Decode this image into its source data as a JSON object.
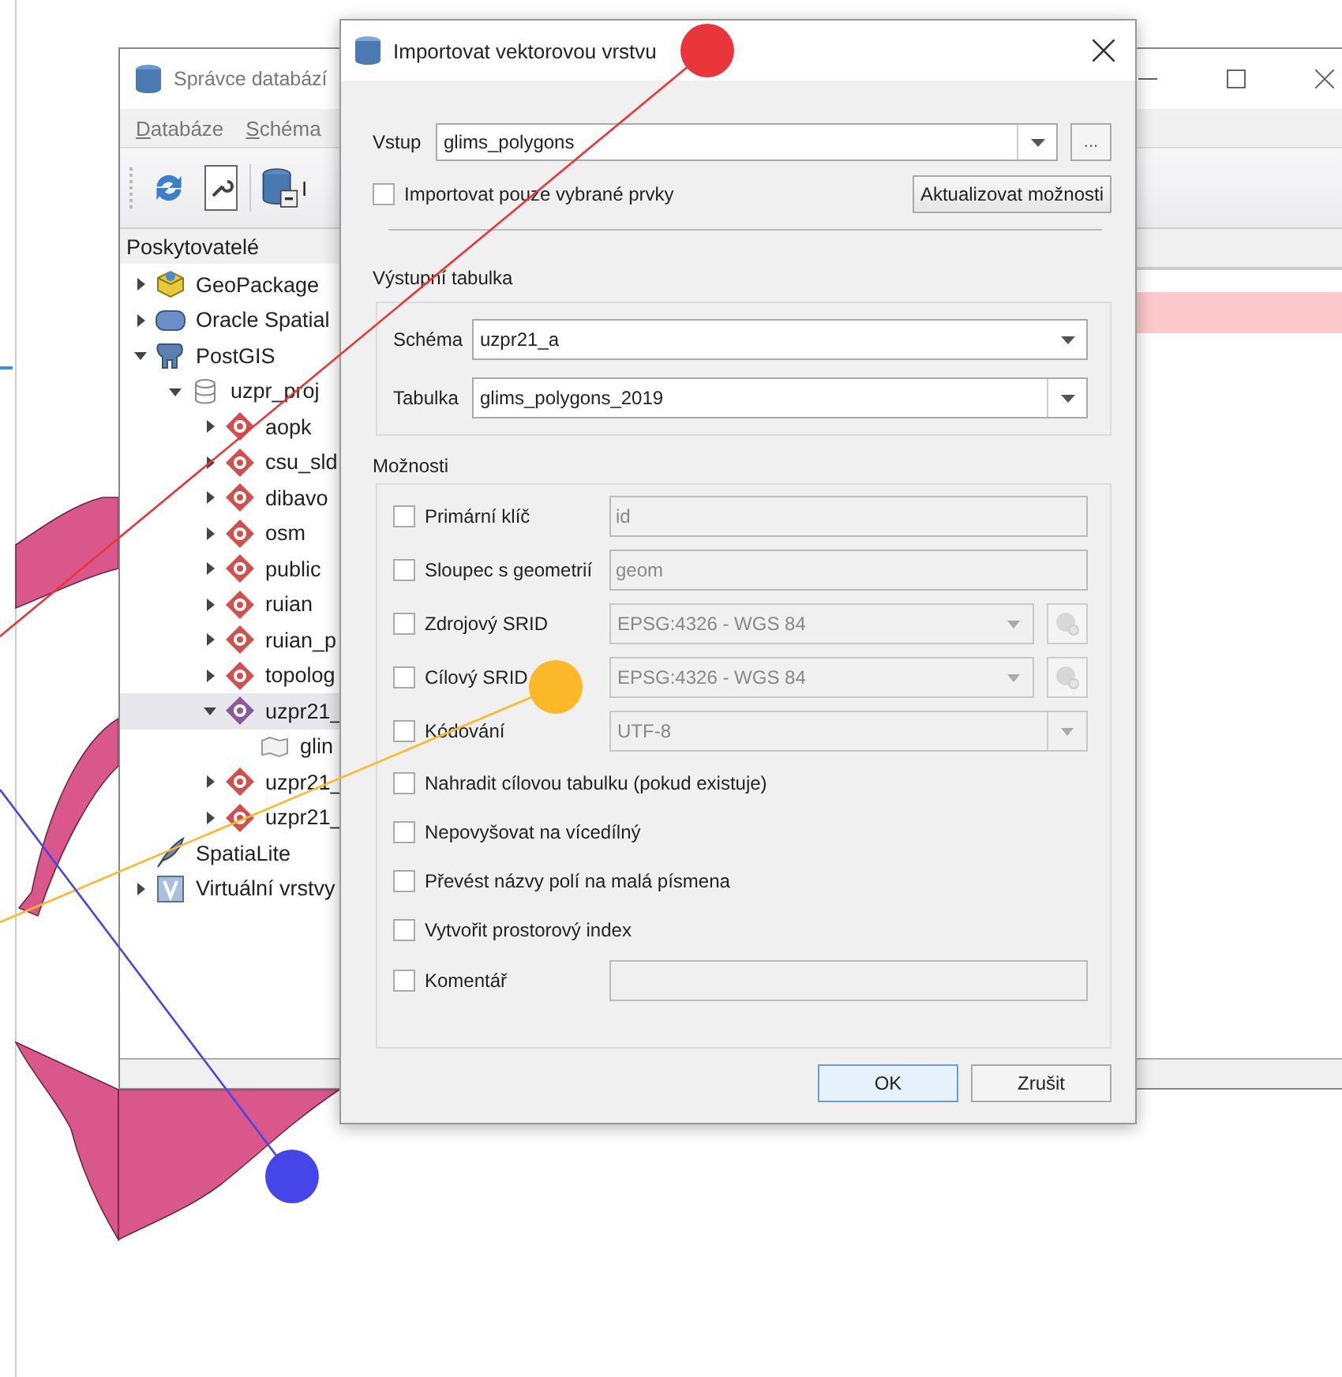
{
  "back_window": {
    "title": "Správce databází",
    "menu": [
      "Databáze",
      "Schéma"
    ],
    "toolbar": [
      {
        "kind": "refresh"
      },
      {
        "kind": "sql"
      },
      {
        "kind": "import",
        "label": "I"
      }
    ],
    "providers_header": "Poskytovatelé",
    "tree": [
      {
        "label": "GeoPackage",
        "kind": "geopackage",
        "expanded": false,
        "selected": false
      },
      {
        "label": "Oracle Spatial",
        "kind": "oracle",
        "expanded": false,
        "selected": false
      },
      {
        "label": "PostGIS",
        "kind": "postgis",
        "expanded": true,
        "selected": false,
        "children": [
          {
            "label": "uzpr_proj",
            "kind": "database",
            "expanded": true,
            "selected": false,
            "children": [
              {
                "label": "aopk",
                "kind": "schema",
                "expanded": false,
                "selected": false
              },
              {
                "label": "csu_sld",
                "kind": "schema",
                "expanded": false,
                "selected": false
              },
              {
                "label": "dibavo",
                "kind": "schema",
                "expanded": false,
                "selected": false
              },
              {
                "label": "osm",
                "kind": "schema",
                "expanded": false,
                "selected": false
              },
              {
                "label": "public",
                "kind": "schema",
                "expanded": false,
                "selected": false
              },
              {
                "label": "ruian",
                "kind": "schema",
                "expanded": false,
                "selected": false
              },
              {
                "label": "ruian_p",
                "kind": "schema",
                "expanded": false,
                "selected": false
              },
              {
                "label": "topolog",
                "kind": "schema",
                "expanded": false,
                "selected": false
              },
              {
                "label": "uzpr21_",
                "kind": "schema",
                "expanded": true,
                "selected": true,
                "children": [
                  {
                    "label": "glin",
                    "kind": "polygon",
                    "selected": false
                  }
                ]
              },
              {
                "label": "uzpr21_",
                "kind": "schema",
                "expanded": false,
                "selected": false
              },
              {
                "label": "uzpr21_",
                "kind": "schema",
                "expanded": false,
                "selected": false
              }
            ]
          }
        ]
      },
      {
        "label": "SpatiaLite",
        "kind": "spatialite",
        "selected": false
      },
      {
        "label": "Virtuální vrstvy",
        "kind": "virtual",
        "expanded": false,
        "selected": false
      }
    ]
  },
  "dialog": {
    "title": "Importovat vektorovou vrstvu",
    "input": {
      "label": "Vstup",
      "value": "glims_polygons",
      "browse": "..."
    },
    "selected_only": {
      "label": "Importovat pouze vybrané prvky",
      "checked": false
    },
    "update_button": "Aktualizovat možnosti",
    "output": {
      "title": "Výstupní tabulka",
      "schema_label": "Schéma",
      "schema": "uzpr21_a",
      "table_label": "Tabulka",
      "table": "glims_polygons_2019"
    },
    "options": {
      "title": "Možnosti",
      "items": [
        {
          "kind": "text",
          "label": "Primární klíč",
          "checked": false,
          "value": "id",
          "disabled": true
        },
        {
          "kind": "text",
          "label": "Sloupec s geometrií",
          "checked": false,
          "value": "geom",
          "disabled": true
        },
        {
          "kind": "crs",
          "label": "Zdrojový SRID",
          "checked": false,
          "value": "EPSG:4326 - WGS 84",
          "disabled": true
        },
        {
          "kind": "crs",
          "label": "Cílový SRID",
          "checked": false,
          "value": "EPSG:4326 - WGS 84",
          "disabled": true
        },
        {
          "kind": "combo",
          "label": "Kódování",
          "checked": false,
          "value": "UTF-8",
          "disabled": true
        },
        {
          "kind": "check",
          "label": "Nahradit cílovou tabulku (pokud existuje)",
          "checked": false
        },
        {
          "kind": "check",
          "label": "Nepovyšovat na vícedílný",
          "checked": false
        },
        {
          "kind": "check",
          "label": "Převést názvy polí na malá písmena",
          "checked": false
        },
        {
          "kind": "check",
          "label": "Vytvořit prostorový index",
          "checked": false
        },
        {
          "kind": "text",
          "label": "Komentář",
          "checked": false,
          "disabled": true
        }
      ]
    },
    "buttons": [
      {
        "label": "OK",
        "default": true
      },
      {
        "label": "Zrušit",
        "default": false
      }
    ]
  },
  "annotations": [
    {
      "color": "#e8363a"
    },
    {
      "color": "#fbb829"
    },
    {
      "color": "#4646e8"
    }
  ]
}
